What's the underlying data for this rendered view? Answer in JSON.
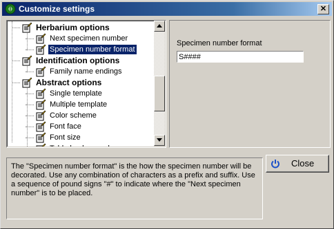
{
  "window": {
    "title": "Customize settings",
    "close_glyph": "✕"
  },
  "tree": {
    "items": [
      {
        "label": "Herbarium options",
        "type": "group"
      },
      {
        "label": "Next specimen number",
        "type": "item"
      },
      {
        "label": "Specimen number format",
        "type": "item",
        "selected": true
      },
      {
        "label": "Identification options",
        "type": "group"
      },
      {
        "label": "Family name endings",
        "type": "item"
      },
      {
        "label": "Abstract options",
        "type": "group"
      },
      {
        "label": "Single template",
        "type": "item"
      },
      {
        "label": "Multiple template",
        "type": "item"
      },
      {
        "label": "Color scheme",
        "type": "item"
      },
      {
        "label": "Font face",
        "type": "item"
      },
      {
        "label": "Font size",
        "type": "item"
      },
      {
        "label": "Table background",
        "type": "item"
      }
    ]
  },
  "settings": {
    "field_label": "Specimen number format",
    "field_value": "S####"
  },
  "help": {
    "text": "The \"Specimen number format\" is the how the specimen number will be decorated.  Use any combination of characters as a prefix and suffix.  Use a sequence of pound signs \"#\" to indicate where the \"Next specimen number\" is to be placed."
  },
  "buttons": {
    "close_label": "Close"
  },
  "icons": {
    "title": "leaf-icon",
    "tree_item": "notepad-pencil-icon",
    "close_button": "power-icon"
  }
}
